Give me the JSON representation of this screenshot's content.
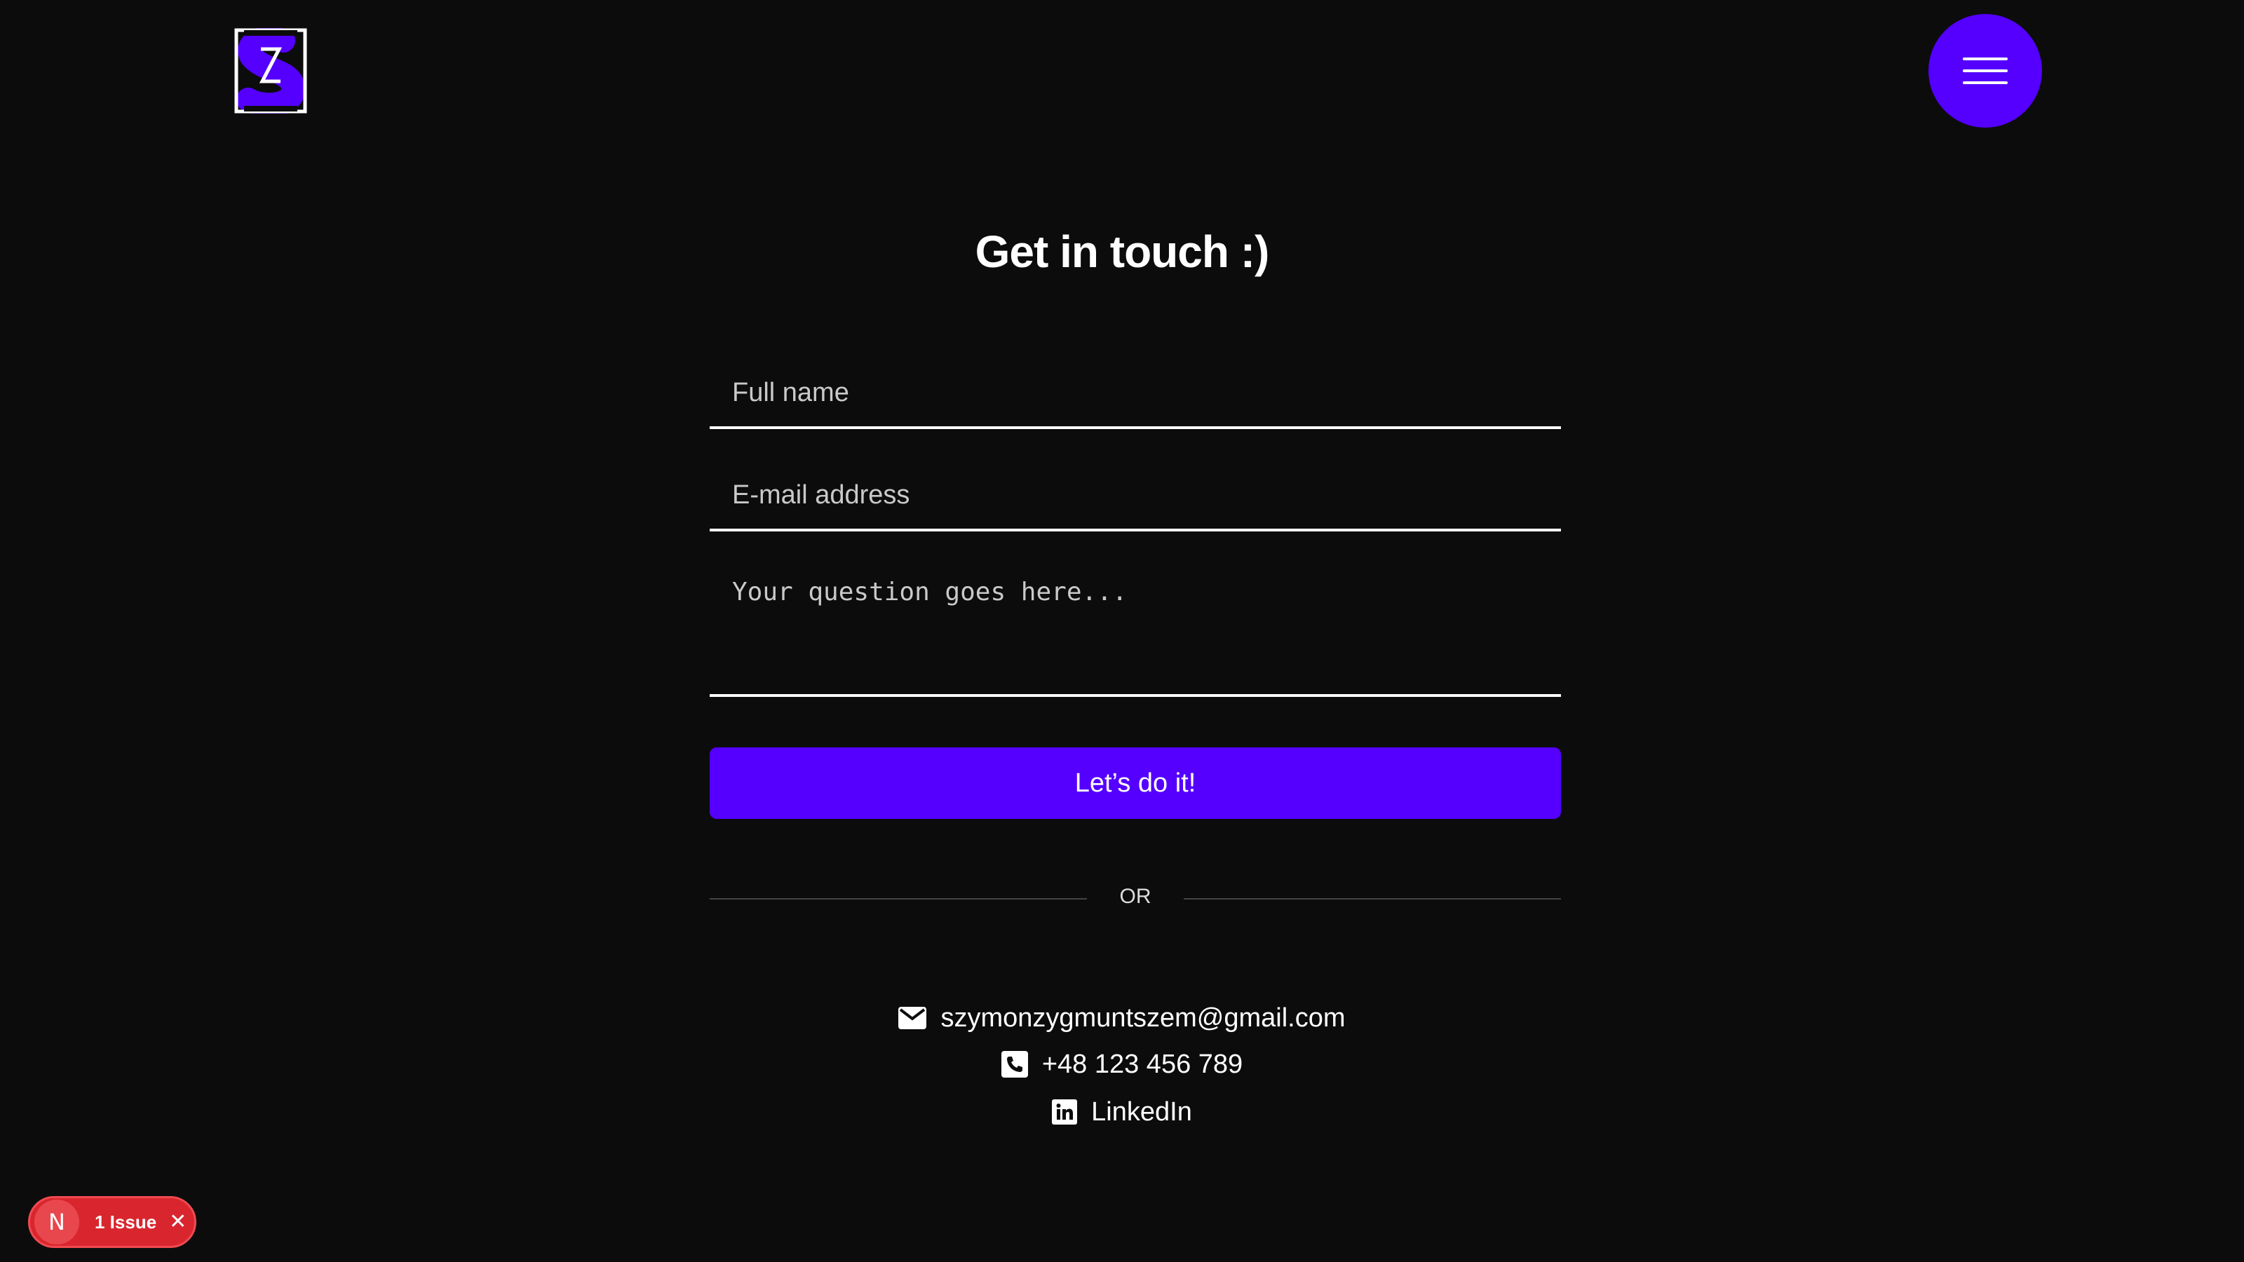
{
  "header": {
    "logo_icon": "z-logo-icon",
    "menu_icon": "hamburger-menu-icon",
    "accent_color": "#5500ff"
  },
  "contact_form": {
    "title": "Get in touch :)",
    "name_placeholder": "Full name",
    "name_value": "",
    "email_placeholder": "E-mail address",
    "email_value": "",
    "question_placeholder": "Your question goes here...",
    "question_value": "",
    "submit_label": "Let’s do it!",
    "divider_label": "OR"
  },
  "contacts": {
    "email": {
      "icon": "mail-icon",
      "text": "szymonzygmuntszem@gmail.com"
    },
    "phone": {
      "icon": "phone-icon",
      "text": "+48 123 456 789"
    },
    "linkedin": {
      "icon": "linkedin-icon",
      "text": "LinkedIn"
    }
  },
  "dev_overlay": {
    "letter": "N",
    "issues_text": "1 Issue",
    "close_icon": "close-icon",
    "color": "#d9262e"
  }
}
